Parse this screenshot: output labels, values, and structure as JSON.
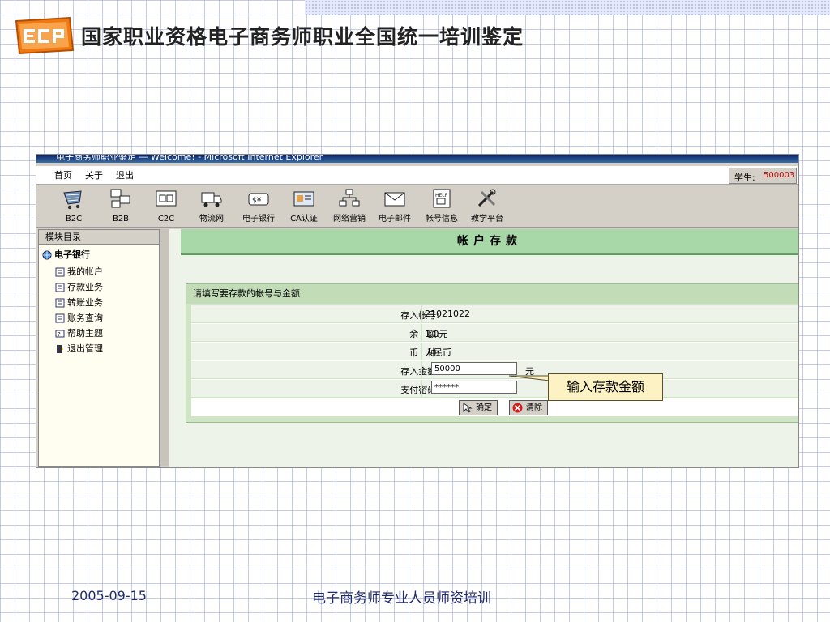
{
  "slide": {
    "title": "国家职业资格电子商务师职业全国统一培训鉴定",
    "logo_text": "ECP",
    "footer_date": "2005-09-15",
    "footer_title": "电子商务师专业人员师资培训",
    "callout": "输入存款金额"
  },
  "window": {
    "title": "电子商务师职业鉴定 — Welcome! - Microsoft Internet Explorer"
  },
  "menu": {
    "items": [
      "首页",
      "关于",
      "退出"
    ],
    "student_label": "学生:",
    "student_id": "500003"
  },
  "toolbar": {
    "items": [
      {
        "label": "B2C",
        "icon": "cart-icon"
      },
      {
        "label": "B2B",
        "icon": "b2b-icon"
      },
      {
        "label": "C2C",
        "icon": "c2c-icon"
      },
      {
        "label": "物流网",
        "icon": "truck-icon"
      },
      {
        "label": "电子银行",
        "icon": "bank-icon"
      },
      {
        "label": "CA认证",
        "icon": "certificate-icon"
      },
      {
        "label": "网络营销",
        "icon": "network-icon"
      },
      {
        "label": "电子邮件",
        "icon": "mail-icon"
      },
      {
        "label": "帐号信息",
        "icon": "help-book-icon"
      },
      {
        "label": "教学平台",
        "icon": "tools-icon"
      }
    ]
  },
  "sidebar": {
    "header": "模块目录",
    "root": "电子银行",
    "items": [
      "我的帐户",
      "存款业务",
      "转账业务",
      "账务查询",
      "帮助主题",
      "退出管理"
    ]
  },
  "page": {
    "header": "帐户存款",
    "caption": "请填写要存款的帐号与金额",
    "rows": [
      {
        "label": "存入帐号:",
        "value": "21021022"
      },
      {
        "label": "余　额:",
        "value": "1.0元"
      },
      {
        "label": "币　种:",
        "value": "人民币"
      }
    ],
    "amount_label": "存入金额:",
    "amount_value": "50000",
    "amount_unit": "元",
    "password_label": "支付密码:",
    "password_value": "******",
    "ok_button": "确定",
    "clear_button": "清除"
  }
}
